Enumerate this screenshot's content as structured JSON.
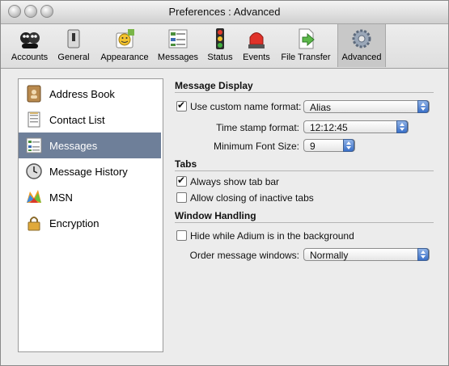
{
  "window": {
    "title": "Preferences : Advanced"
  },
  "toolbar": {
    "items": [
      {
        "label": "Accounts",
        "icon": "accounts-icon"
      },
      {
        "label": "General",
        "icon": "general-icon"
      },
      {
        "label": "Appearance",
        "icon": "appearance-icon"
      },
      {
        "label": "Messages",
        "icon": "messages-icon"
      },
      {
        "label": "Status",
        "icon": "status-icon"
      },
      {
        "label": "Events",
        "icon": "events-icon"
      },
      {
        "label": "File Transfer",
        "icon": "file-transfer-icon"
      },
      {
        "label": "Advanced",
        "icon": "advanced-icon",
        "selected": true
      }
    ]
  },
  "sidebar": {
    "items": [
      {
        "label": "Address Book",
        "icon": "address-book-icon"
      },
      {
        "label": "Contact List",
        "icon": "contact-list-icon"
      },
      {
        "label": "Messages",
        "icon": "messages-icon",
        "selected": true
      },
      {
        "label": "Message History",
        "icon": "clock-icon"
      },
      {
        "label": "MSN",
        "icon": "msn-icon"
      },
      {
        "label": "Encryption",
        "icon": "lock-icon"
      }
    ]
  },
  "message_display": {
    "heading": "Message Display",
    "custom_name": {
      "label": "Use custom name format:",
      "checked": true,
      "value": "Alias"
    },
    "timestamp": {
      "label": "Time stamp format:",
      "value": "12:12:45"
    },
    "min_font": {
      "label": "Minimum Font Size:",
      "value": "9"
    }
  },
  "tabs": {
    "heading": "Tabs",
    "always_show": {
      "label": "Always show tab bar",
      "checked": true
    },
    "allow_closing": {
      "label": "Allow closing of inactive tabs",
      "checked": false
    }
  },
  "window_handling": {
    "heading": "Window Handling",
    "hide_background": {
      "label": "Hide while Adium is in the background",
      "checked": false
    },
    "order": {
      "label": "Order message windows:",
      "value": "Normally"
    }
  },
  "colors": {
    "selection": "#6e7f99",
    "popup_arrow": "#3a70c9"
  }
}
